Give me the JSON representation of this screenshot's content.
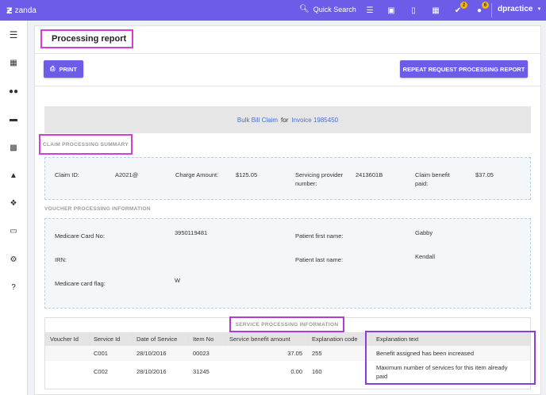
{
  "topbar": {
    "logo_text": "zanda",
    "quick_search": "Quick Search",
    "badges": {
      "tasks": "2",
      "messages": "6"
    },
    "user": "dpractice"
  },
  "page": {
    "title": "Processing report",
    "print_label": "PRINT",
    "repeat_label": "REPEAT REQUEST PROCESSING REPORT"
  },
  "claim_banner": {
    "claim_link": "Bulk Bill Claim",
    "connector": "for",
    "invoice_link": "Invoice 1985450"
  },
  "claim_summary": {
    "heading": "CLAIM PROCESSING SUMMARY",
    "claim_id_label": "Claim ID:",
    "claim_id_value": "A2021@",
    "charge_amount_label": "Charge Amount:",
    "charge_amount_value": "$125.05",
    "provider_label_1": "Servicing provider",
    "provider_label_2": "number:",
    "provider_value": "2413601B",
    "benefit_label_1": "Claim benefit",
    "benefit_label_2": "paid:",
    "benefit_value": "$37.05"
  },
  "voucher": {
    "heading": "VOUCHER PROCESSING INFORMATION",
    "medicare_card_label": "Medicare Card No:",
    "medicare_card_value": "3950119481",
    "irn_label": "IRN:",
    "medicare_flag_label": "Medicare card flag:",
    "medicare_flag_value": "W",
    "first_name_label": "Patient first name:",
    "first_name_value": "Gabby",
    "last_name_label": "Patient last name:",
    "last_name_value": "Kendall"
  },
  "service": {
    "heading": "SERVICE PROCESSING INFORMATION",
    "columns": [
      "Voucher Id",
      "Service Id",
      "Date of Service",
      "Item No",
      "Service benefit amount",
      "Explanation code",
      "Explanation text"
    ],
    "rows": [
      {
        "voucher_id": "",
        "service_id": "C001",
        "date": "28/10/2016",
        "item_no": "00023",
        "amount": "37.05",
        "code": "255",
        "text": "Benefit assigned has been increased"
      },
      {
        "voucher_id": "",
        "service_id": "C002",
        "date": "28/10/2016",
        "item_no": "31245",
        "amount": "0.00",
        "code": "160",
        "text_1": "Maximum number of services for this item already",
        "text_2": "paid"
      }
    ]
  },
  "colors": {
    "accent": "#6c5ce7",
    "highlight": "#d63cd6"
  }
}
